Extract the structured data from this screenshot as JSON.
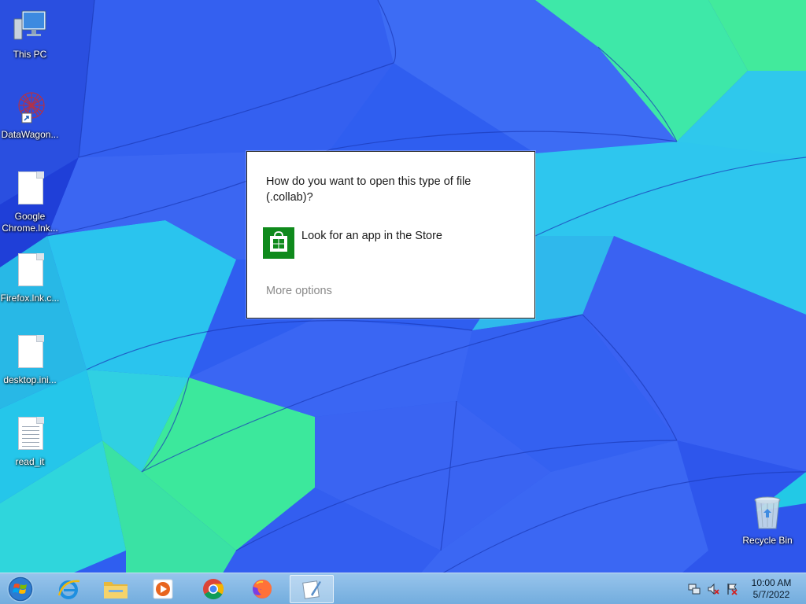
{
  "desktop": {
    "icons": [
      {
        "label": "This PC"
      },
      {
        "label": "DataWagon..."
      },
      {
        "label": "Google\nChrome.lnk..."
      },
      {
        "label": "Firefox.lnk.c..."
      },
      {
        "label": "desktop.ini..."
      },
      {
        "label": "read_it"
      },
      {
        "label": "Recycle Bin"
      }
    ]
  },
  "dialog": {
    "question": "How do you want to open this type of file (.collab)?",
    "store_option": "Look for an app in the Store",
    "more_options": "More options"
  },
  "taskbar": {
    "clock_time": "10:00 AM",
    "clock_date": "5/7/2022"
  },
  "colors": {
    "store_tile": "#0f8a1c",
    "wallpaper_blue": "#2f5ef0",
    "wallpaper_cyan": "#27c4ea",
    "wallpaper_green": "#3ae6a0"
  }
}
